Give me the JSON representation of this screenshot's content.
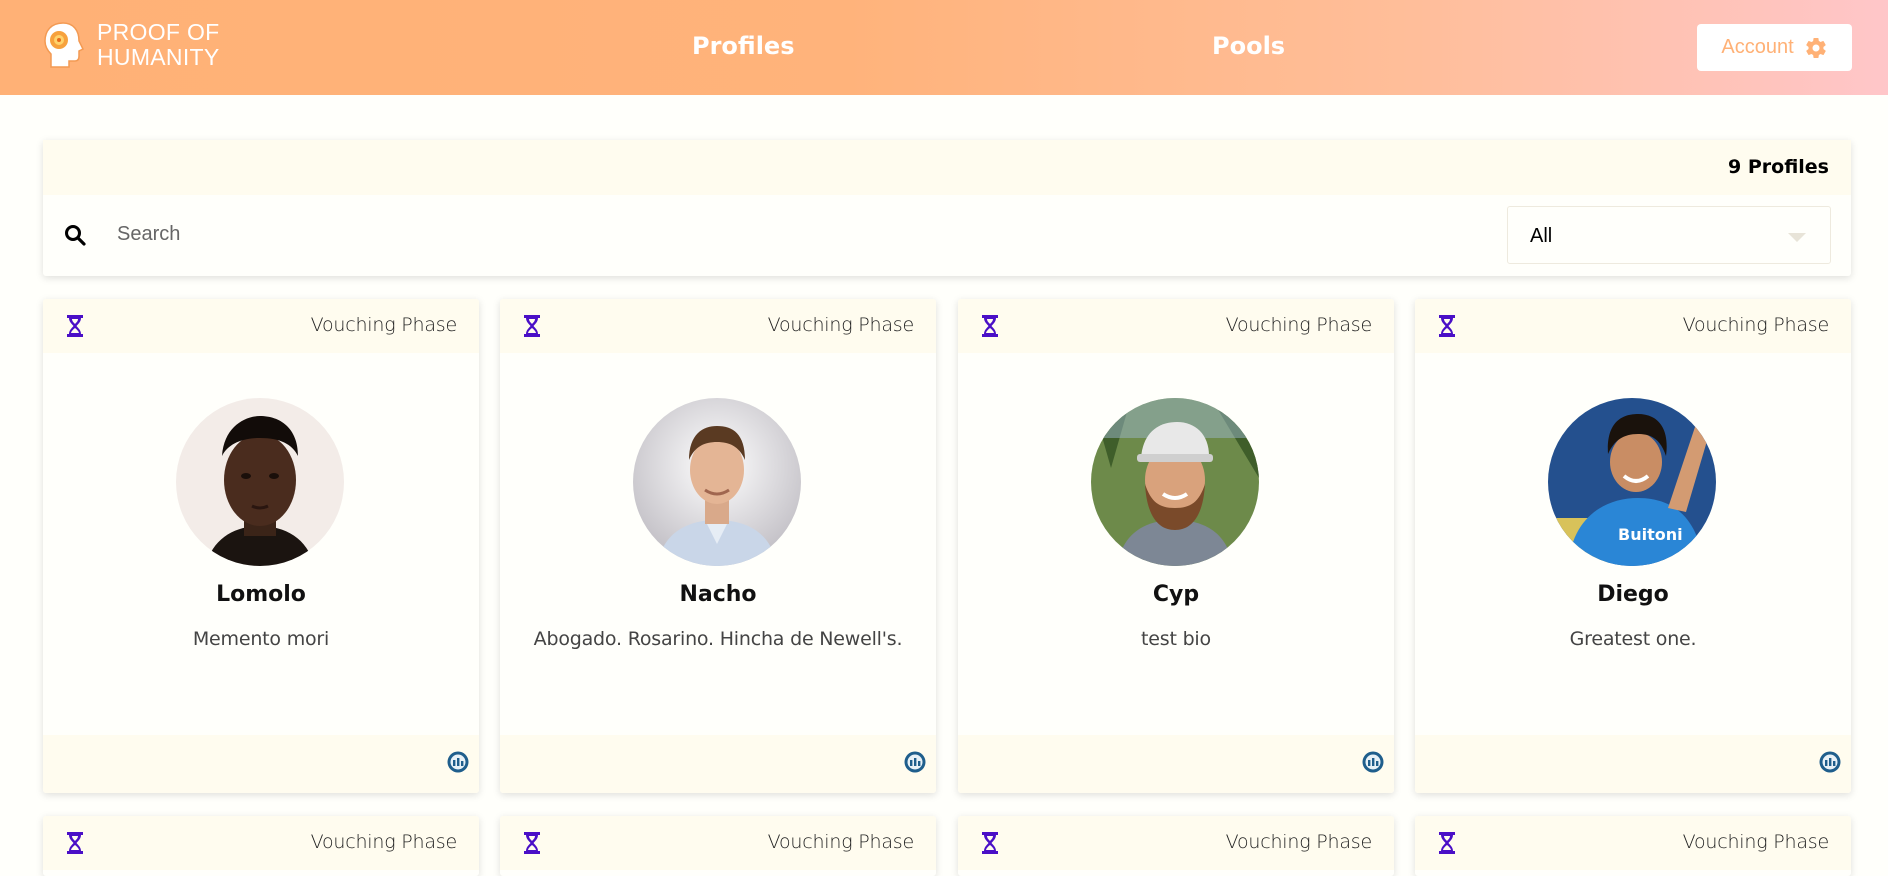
{
  "header": {
    "brand": {
      "line1": "PROOF OF",
      "line2": "HUMANITY",
      "logo_icon": "humanity-head-icon"
    },
    "nav": [
      {
        "label": "Profiles"
      },
      {
        "label": "Pools"
      }
    ],
    "account": {
      "label": "Account",
      "icon": "gear-icon"
    },
    "colors": {
      "gradient_start": "#ffb176",
      "gradient_end": "#ffc6c9",
      "accent": "#ffb176"
    }
  },
  "filters": {
    "count_label": "9 Profiles",
    "search": {
      "placeholder": "Search",
      "value": "",
      "icon": "search-icon"
    },
    "status_select": {
      "value": "All"
    }
  },
  "profiles": [
    {
      "status": "Vouching Phase",
      "name": "Lomolo",
      "bio": "Memento mori"
    },
    {
      "status": "Vouching Phase",
      "name": "Nacho",
      "bio": "Abogado. Rosarino. Hincha de Newell's."
    },
    {
      "status": "Vouching Phase",
      "name": "Cyp",
      "bio": "test bio"
    },
    {
      "status": "Vouching Phase",
      "name": "Diego",
      "bio": "Greatest one."
    },
    {
      "status": "Vouching Phase"
    },
    {
      "status": "Vouching Phase"
    },
    {
      "status": "Vouching Phase"
    },
    {
      "status": "Vouching Phase"
    }
  ],
  "status_icon": "hourglass-icon",
  "status_color": "#4a0fc7",
  "badge_icon": "poh-token-icon"
}
